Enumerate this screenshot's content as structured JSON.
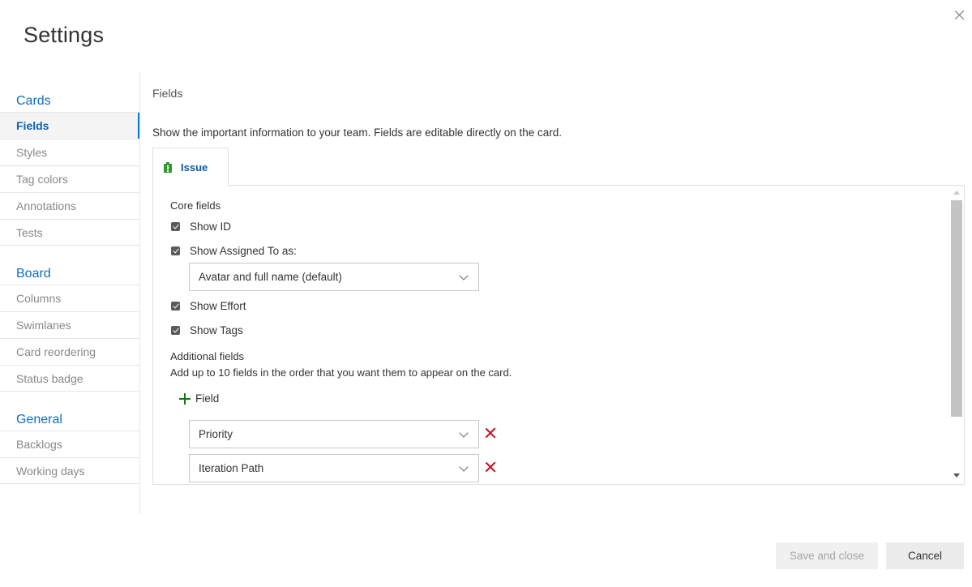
{
  "dialog": {
    "title": "Settings"
  },
  "nav": {
    "groups": [
      {
        "title": "Cards",
        "items": [
          "Fields",
          "Styles",
          "Tag colors",
          "Annotations",
          "Tests"
        ]
      },
      {
        "title": "Board",
        "items": [
          "Columns",
          "Swimlanes",
          "Card reordering",
          "Status badge"
        ]
      },
      {
        "title": "General",
        "items": [
          "Backlogs",
          "Working days"
        ]
      }
    ],
    "selected": "Fields"
  },
  "main": {
    "section_title": "Fields",
    "description": "Show the important information to your team. Fields are editable directly on the card.",
    "tab": {
      "label": "Issue",
      "icon": "issue-icon",
      "icon_color": "#339933"
    },
    "core_fields": {
      "heading": "Core fields",
      "show_id": {
        "label": "Show ID",
        "checked": true
      },
      "show_assigned": {
        "label": "Show Assigned To as:",
        "checked": true
      },
      "assigned_select": {
        "value": "Avatar and full name (default)"
      },
      "show_effort": {
        "label": "Show Effort",
        "checked": true
      },
      "show_tags": {
        "label": "Show Tags",
        "checked": true
      }
    },
    "additional_fields": {
      "heading": "Additional fields",
      "hint": "Add up to 10 fields in the order that you want them to appear on the card.",
      "add_label": "Field",
      "fields": [
        {
          "value": "Priority"
        },
        {
          "value": "Iteration Path"
        }
      ]
    }
  },
  "footer": {
    "save_label": "Save and close",
    "cancel_label": "Cancel"
  },
  "colors": {
    "accent": "#0078d4",
    "add": "#107c10",
    "remove": "#c50f1f"
  }
}
